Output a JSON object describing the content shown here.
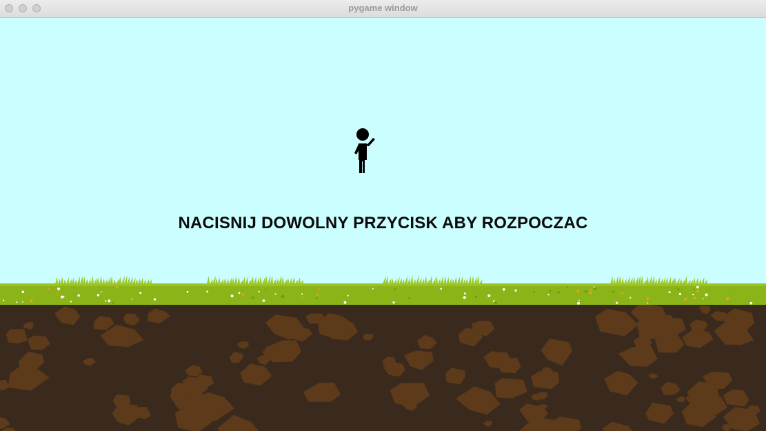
{
  "window": {
    "title": "pygame window"
  },
  "game": {
    "start_prompt": "NACISNIJ DOWOLNY PRZYCISK ABY ROZPOCZAC",
    "player_icon": "waving-person-icon"
  },
  "colors": {
    "sky": "#cbfefe",
    "grass": "#8ab418",
    "dirt": "#3a2a1e",
    "rock": "#5c3a1a",
    "text": "#0a0a0a"
  }
}
